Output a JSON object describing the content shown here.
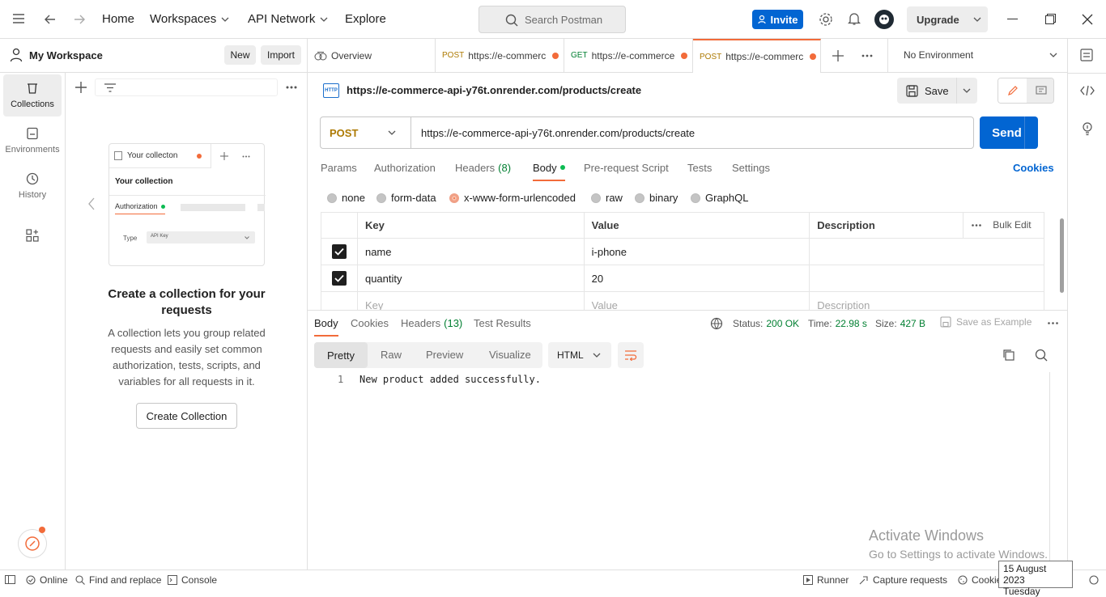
{
  "topbar": {
    "home": "Home",
    "workspaces": "Workspaces",
    "api_network": "API Network",
    "explore": "Explore",
    "search_placeholder": "Search Postman",
    "invite": "Invite",
    "upgrade": "Upgrade"
  },
  "sidebar": {
    "workspace_name": "My Workspace",
    "new": "New",
    "import": "Import",
    "rail": [
      {
        "label": "Collections",
        "icon": "trash-can-icon"
      },
      {
        "label": "Environments",
        "icon": "environment-icon"
      },
      {
        "label": "History",
        "icon": "history-icon"
      },
      {
        "label": "",
        "icon": "grid-plus-icon"
      }
    ],
    "illustration": {
      "tab_label": "Your collecton",
      "collection_label": "Your collection",
      "auth_label": "Authorization",
      "type_label": "Type",
      "type_value": "API Key"
    },
    "empty_title": "Create a collection for your requests",
    "empty_desc": "A collection lets you group related requests and easily set common authorization, tests, scripts, and variables for all requests in it.",
    "create_button": "Create Collection"
  },
  "tabs": [
    {
      "method": "",
      "label": "Overview",
      "dirty": false
    },
    {
      "method": "POST",
      "label": "https://e-commerc",
      "dirty": true
    },
    {
      "method": "GET",
      "label": "https://e-commerce",
      "dirty": true
    },
    {
      "method": "POST",
      "label": "https://e-commerc",
      "dirty": true,
      "active": true
    }
  ],
  "environment": "No Environment",
  "request": {
    "title": "https://e-commerce-api-y76t.onrender.com/products/create",
    "save": "Save",
    "method": "POST",
    "url": "https://e-commerce-api-y76t.onrender.com/products/create",
    "send": "Send",
    "subtabs": {
      "params": "Params",
      "authorization": "Authorization",
      "headers": "Headers",
      "headers_count": "(8)",
      "body": "Body",
      "prerequest": "Pre-request Script",
      "tests": "Tests",
      "settings": "Settings",
      "cookies": "Cookies"
    },
    "body_modes": [
      "none",
      "form-data",
      "x-www-form-urlencoded",
      "raw",
      "binary",
      "GraphQL"
    ],
    "table": {
      "headers": {
        "key": "Key",
        "value": "Value",
        "description": "Description",
        "bulk_edit": "Bulk Edit"
      },
      "rows": [
        {
          "key": "name",
          "value": "i-phone",
          "description": ""
        },
        {
          "key": "quantity",
          "value": "20",
          "description": ""
        }
      ],
      "placeholder": {
        "key": "Key",
        "value": "Value",
        "description": "Description"
      }
    }
  },
  "response": {
    "tabs": {
      "body": "Body",
      "cookies": "Cookies",
      "headers": "Headers",
      "headers_count": "(13)",
      "test_results": "Test Results"
    },
    "status_label": "Status:",
    "status_value": "200 OK",
    "time_label": "Time:",
    "time_value": "22.98 s",
    "size_label": "Size:",
    "size_value": "427 B",
    "save_example": "Save as Example",
    "formats": [
      "Pretty",
      "Raw",
      "Preview",
      "Visualize"
    ],
    "language": "HTML",
    "lines": [
      {
        "n": "1",
        "text": "New product added successfully."
      }
    ]
  },
  "footer": {
    "online": "Online",
    "find_replace": "Find and replace",
    "console": "Console",
    "runner": "Runner",
    "capture": "Capture requests",
    "cookies": "Cookie"
  },
  "watermark": {
    "title": "Activate Windows",
    "subtitle": "Go to Settings to activate Windows."
  },
  "tooltip": {
    "date": "15 August 2023",
    "day": "Tuesday"
  },
  "colors": {
    "accent": "#0265d2",
    "orange": "#f26b3a",
    "status_green": "#007f31"
  }
}
